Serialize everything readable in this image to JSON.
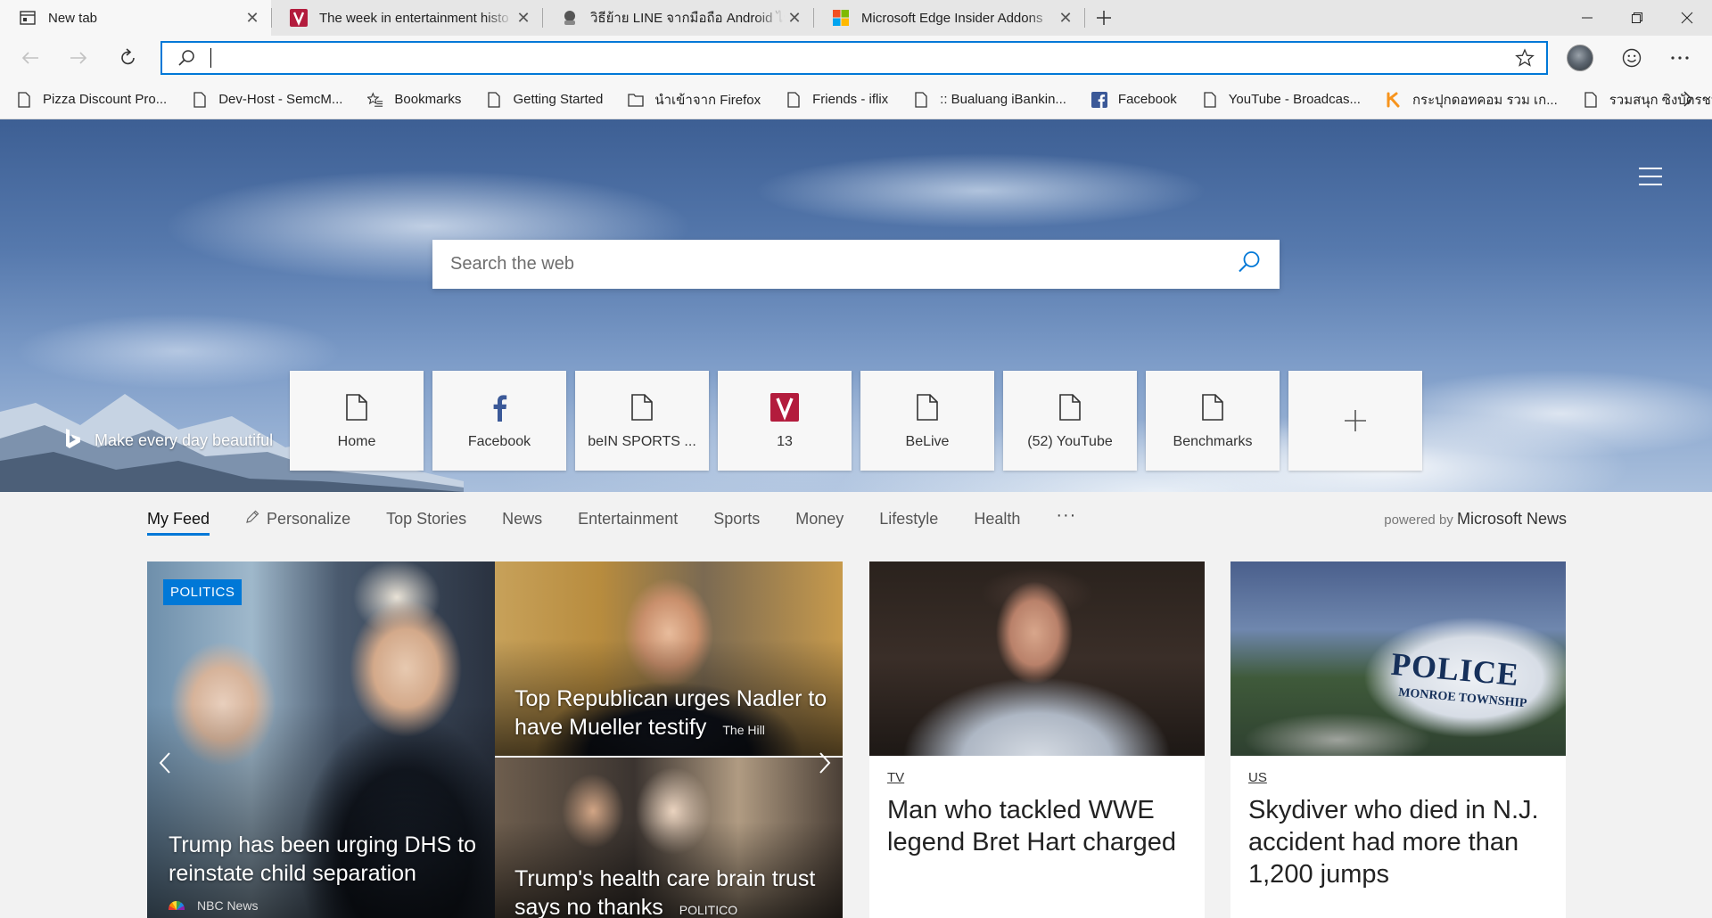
{
  "tabs": [
    {
      "title": "New tab",
      "active": true,
      "icon": "newtab-icon"
    },
    {
      "title": "The week in entertainment histo",
      "active": false,
      "icon": "site-icon"
    },
    {
      "title": "วิธีย้าย LINE จากมือถือ Android ไป",
      "active": false,
      "icon": "site-icon"
    },
    {
      "title": "Microsoft Edge Insider Addons",
      "active": false,
      "icon": "microsoft-icon"
    }
  ],
  "address_bar": {
    "value": "",
    "placeholder": ""
  },
  "favorites": [
    {
      "label": "Pizza Discount Pro...",
      "icon": "page-icon"
    },
    {
      "label": "Dev-Host - SemcM...",
      "icon": "page-icon"
    },
    {
      "label": "Bookmarks",
      "icon": "star-list-icon"
    },
    {
      "label": "Getting Started",
      "icon": "page-icon"
    },
    {
      "label": "นำเข้าจาก Firefox",
      "icon": "folder-icon"
    },
    {
      "label": "Friends - iflix",
      "icon": "page-icon"
    },
    {
      "label": ":: Bualuang iBankin...",
      "icon": "page-icon"
    },
    {
      "label": "Facebook",
      "icon": "facebook-icon"
    },
    {
      "label": "YouTube - Broadcas...",
      "icon": "page-icon"
    },
    {
      "label": "กระปุกดอทคอม รวม เก...",
      "icon": "kapook-icon"
    },
    {
      "label": "รวมสนุก ซิงบัตรชมคอ...",
      "icon": "page-icon"
    }
  ],
  "hero": {
    "search_placeholder": "Search the web",
    "tagline": "Make every day beautiful"
  },
  "tiles": [
    {
      "label": "Home",
      "icon": "page-icon"
    },
    {
      "label": "Facebook",
      "icon": "facebook-icon"
    },
    {
      "label": "beIN SPORTS ...",
      "icon": "page-icon"
    },
    {
      "label": "13",
      "icon": "site-icon"
    },
    {
      "label": "BeLive",
      "icon": "page-icon"
    },
    {
      "label": "(52) YouTube",
      "icon": "page-icon"
    },
    {
      "label": "Benchmarks",
      "icon": "page-icon"
    }
  ],
  "feed_nav": {
    "items": [
      "My Feed",
      "Personalize",
      "Top Stories",
      "News",
      "Entertainment",
      "Sports",
      "Money",
      "Lifestyle",
      "Health"
    ],
    "more": "···",
    "powered_prefix": "powered by",
    "powered_brand": "Microsoft News"
  },
  "stories": {
    "main": {
      "badge": "POLITICS",
      "title": "Trump has been urging DHS to reinstate child separation",
      "source": "NBC News"
    },
    "side1": {
      "title": "Top Republican urges Nadler to have Mueller testify",
      "source": "The Hill"
    },
    "side2": {
      "title": "Trump's health care brain trust says no thanks",
      "source": "POLITICO"
    },
    "card1": {
      "category": "TV",
      "title": "Man who tackled WWE legend Bret Hart charged"
    },
    "card2": {
      "category": "US",
      "title": "Skydiver who died in N.J. accident had more than 1,200 jumps",
      "image_text_1": "POLICE",
      "image_text_2": "MONROE TOWNSHIP"
    }
  },
  "colors": {
    "accent": "#0078d7",
    "facebook": "#3b5998"
  }
}
